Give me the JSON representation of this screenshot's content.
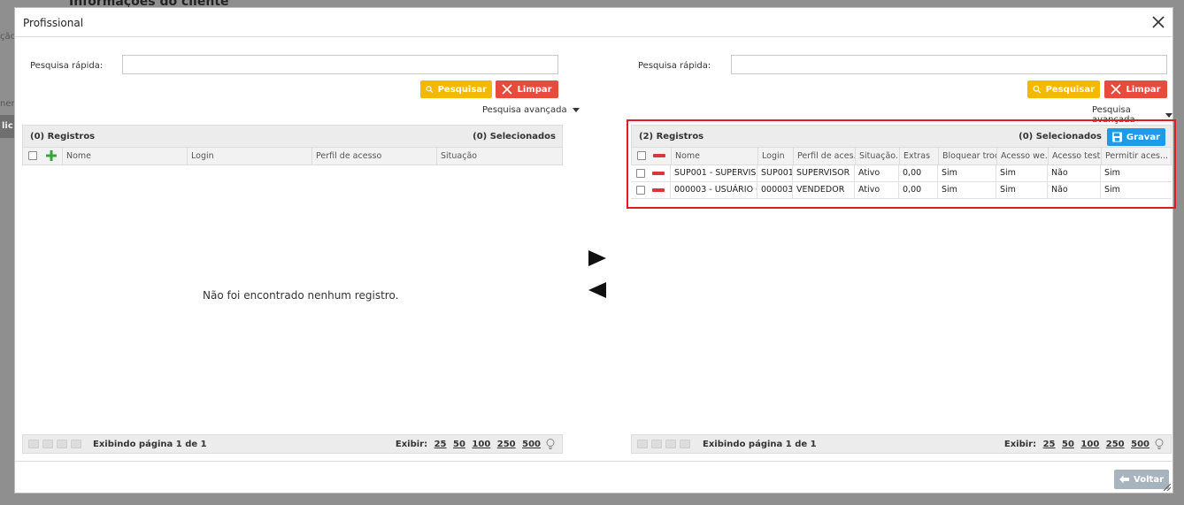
{
  "background": {
    "page_title": "Informações do cliente",
    "frag1": "ção",
    "frag2": "nen",
    "frag3": "lic"
  },
  "modal": {
    "title": "Profissional",
    "close_icon": "close-icon"
  },
  "left": {
    "search_label": "Pesquisa rápida:",
    "search_value": "",
    "search_button": "Pesquisar",
    "clear_button": "Limpar",
    "advanced_search": "Pesquisa avançada",
    "records_label": "(0) Registros",
    "selected_label": "(0) Selecionados",
    "columns": [
      "Nome",
      "Login",
      "Perfil de acesso",
      "Situação"
    ],
    "empty_message": "Não foi encontrado nenhum registro.",
    "pager_info": "Exibindo página 1 de 1",
    "show_label": "Exibir:",
    "page_sizes": [
      "25",
      "50",
      "100",
      "250",
      "500"
    ]
  },
  "right": {
    "search_label": "Pesquisa rápida:",
    "search_value": "",
    "search_button": "Pesquisar",
    "clear_button": "Limpar",
    "advanced_search": "Pesquisa avançada",
    "records_label": "(2) Registros",
    "selected_label": "(0) Selecionados",
    "save_button": "Gravar",
    "columns": [
      "Nome",
      "Login",
      "Perfil de aces...",
      "Situação...",
      "Extras",
      "Bloquear troc...",
      "Acesso we...",
      "Acesso test...",
      "Permitir aces..."
    ],
    "rows": [
      [
        "SUP001 - SUPERVISO...",
        "SUP001",
        "SUPERVISOR",
        "Ativo",
        "0,00",
        "Sim",
        "Sim",
        "Não",
        "Sim"
      ],
      [
        "000003 - USUÁRIO 0...",
        "000003",
        "VENDEDOR",
        "Ativo",
        "0,00",
        "Sim",
        "Sim",
        "Não",
        "Sim"
      ]
    ],
    "pager_info": "Exibindo página 1 de 1",
    "show_label": "Exibir:",
    "page_sizes": [
      "25",
      "50",
      "100",
      "250",
      "500"
    ]
  },
  "transfer": {
    "move_right_icon": "arrow-right-icon",
    "move_left_icon": "arrow-left-icon"
  },
  "footer": {
    "back_button": "Voltar"
  },
  "colors": {
    "search_button": "#f5b800",
    "clear_button": "#e74b3c",
    "save_button": "#1e9be6",
    "highlight": "#e31b23"
  }
}
